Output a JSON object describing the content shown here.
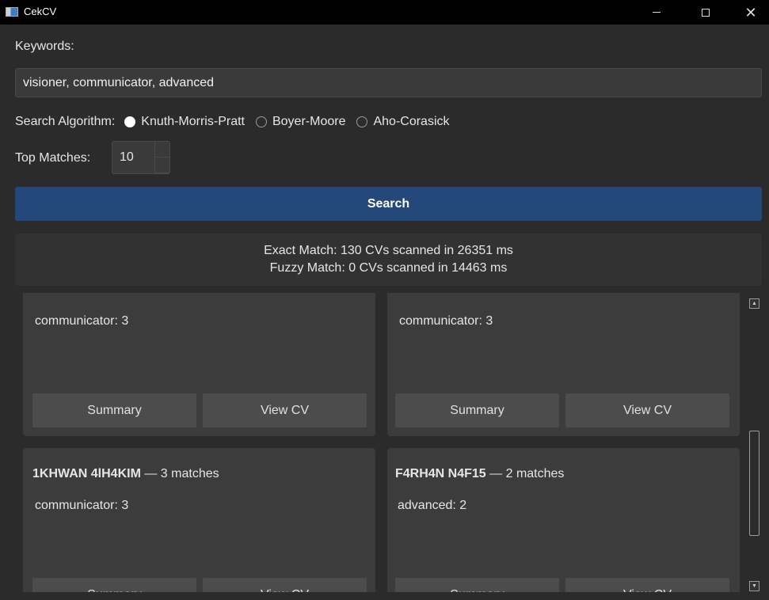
{
  "window": {
    "title": "CekCV"
  },
  "form": {
    "keywords_label": "Keywords:",
    "keywords_value": "visioner, communicator, advanced",
    "algorithm_label": "Search Algorithm:",
    "algorithms": [
      {
        "label": "Knuth-Morris-Pratt",
        "selected": true
      },
      {
        "label": "Boyer-Moore",
        "selected": false
      },
      {
        "label": "Aho-Corasick",
        "selected": false
      }
    ],
    "top_matches_label": "Top Matches:",
    "top_matches_value": "10",
    "search_label": "Search"
  },
  "status": {
    "exact": "Exact Match: 130 CVs scanned in 26351 ms",
    "fuzzy": "Fuzzy Match: 0 CVs scanned in 14463 ms"
  },
  "results": [
    {
      "name": "",
      "count": "",
      "keywords": [
        "communicator: 3"
      ],
      "summary_label": "Summary",
      "view_label": "View CV"
    },
    {
      "name": "",
      "count": "",
      "keywords": [
        "communicator: 3"
      ],
      "summary_label": "Summary",
      "view_label": "View CV"
    },
    {
      "name": "1KHWAN 4lH4KIM",
      "count": " — 3 matches",
      "keywords": [
        "communicator: 3"
      ],
      "summary_label": "Summary",
      "view_label": "View CV"
    },
    {
      "name": "F4RH4N N4F15",
      "count": " — 2 matches",
      "keywords": [
        "advanced: 2"
      ],
      "summary_label": "Summary",
      "view_label": "View CV"
    }
  ],
  "colors": {
    "accent": "#24487a",
    "background": "#2b2b2b",
    "card": "#3c3c3c"
  }
}
